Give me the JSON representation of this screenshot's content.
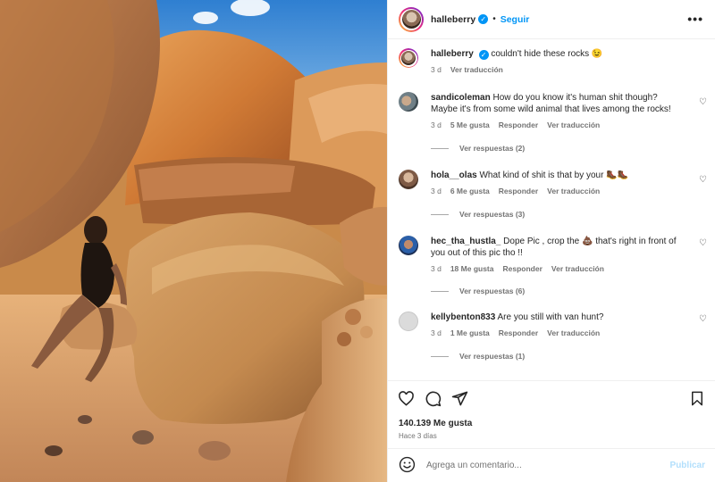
{
  "post": {
    "username": "halleberry",
    "follow_label": "Seguir",
    "separator": "•",
    "caption": {
      "username": "halleberry",
      "text": "couldn't hide these rocks 😉",
      "age": "3 d",
      "translate": "Ver traducción"
    }
  },
  "comments": [
    {
      "username": "sandicoleman",
      "text": "How do you know it's human shit though? Maybe it's from some wild animal that lives among the rocks!",
      "age": "3 d",
      "likes": "5 Me gusta",
      "reply": "Responder",
      "translate": "Ver traducción",
      "view_replies": "Ver respuestas (2)"
    },
    {
      "username": "hola__olas",
      "text": "What kind of shit is that by your 🥾🥾",
      "age": "3 d",
      "likes": "6 Me gusta",
      "reply": "Responder",
      "translate": "Ver traducción",
      "view_replies": "Ver respuestas (3)"
    },
    {
      "username": "hec_tha_hustla_",
      "text": "Dope Pic , crop the 💩 that's right in front of you out of this pic tho !!",
      "age": "3 d",
      "likes": "18 Me gusta",
      "reply": "Responder",
      "translate": "Ver traducción",
      "view_replies": "Ver respuestas (6)"
    },
    {
      "username": "kellybenton833",
      "text": "Are you still with van hunt?",
      "age": "3 d",
      "likes": "1 Me gusta",
      "reply": "Responder",
      "translate": "Ver traducción",
      "view_replies": "Ver respuestas (1)"
    }
  ],
  "actions": {
    "likes_count": "140.139 Me gusta",
    "posted_ago": "Hace 3 días",
    "icons": [
      "heart-icon",
      "comment-icon",
      "share-icon",
      "bookmark-icon"
    ]
  },
  "add_comment": {
    "placeholder": "Agrega un comentario...",
    "publish_label": "Publicar"
  },
  "colors": {
    "accent": "#0095f6",
    "publish_disabled": "#b2dffc",
    "muted_text": "#737373",
    "divider": "#efefef"
  }
}
